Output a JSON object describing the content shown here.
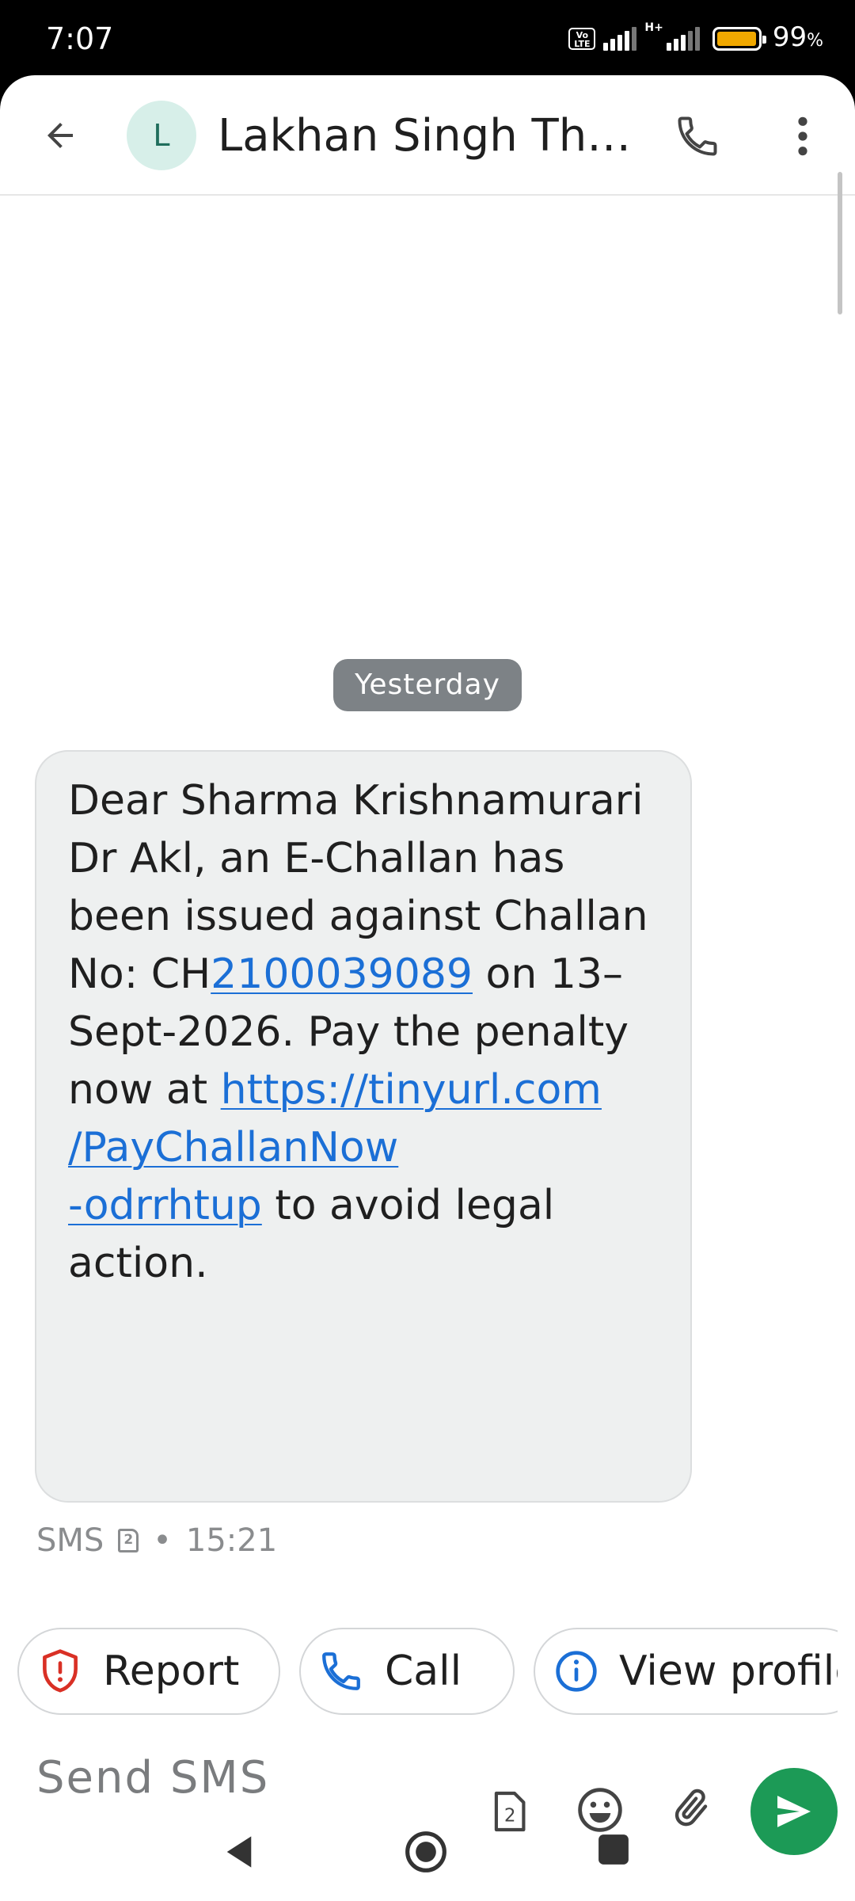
{
  "status_bar": {
    "time": "7:07",
    "volte": "Vo LTE",
    "network": "H+",
    "battery_level": 0.99,
    "battery_label": "99",
    "battery_unit": "%"
  },
  "header": {
    "avatar_letter": "L",
    "contact_name": "Lakhan Singh Th…"
  },
  "conversation": {
    "date_divider": "Yesterday",
    "message": {
      "text_1": "Dear Sharma Krishnamurari Dr Akl, an E-Challan has been issued against Challan No: CH",
      "link_number": "2100039089",
      "text_2": " on 13–Sept-2026. Pay the penalty now at ",
      "link_url_line1": "https://tinyurl.com",
      "link_url_line2": "/PayChallanNow",
      "link_url_line3": "-odrrhtup",
      "text_3": " to avoid legal action."
    },
    "meta": {
      "type": "SMS",
      "sim": "2",
      "separator": "•",
      "time": "15:21"
    }
  },
  "actions": {
    "report_label": "Report",
    "call_label": "Call",
    "view_profile_label": "View profile"
  },
  "compose": {
    "placeholder": "Send SMS",
    "sim_number": "2"
  },
  "colors": {
    "link": "#1b6fd6",
    "send": "#1c9a56",
    "report_icon": "#d93025",
    "call_icon": "#1b6fd6",
    "info_icon": "#1b6fd6",
    "avatar_bg": "#d7efe9",
    "date_chip": "#7d8286",
    "battery": "#f0a800"
  },
  "icons": [
    "back-arrow-icon",
    "phone-icon",
    "more-vert-icon",
    "sim-icon",
    "shield-alert-icon",
    "info-icon",
    "emoji-icon",
    "attach-icon",
    "send-icon",
    "nav-back-icon",
    "nav-home-icon",
    "nav-recents-icon"
  ]
}
